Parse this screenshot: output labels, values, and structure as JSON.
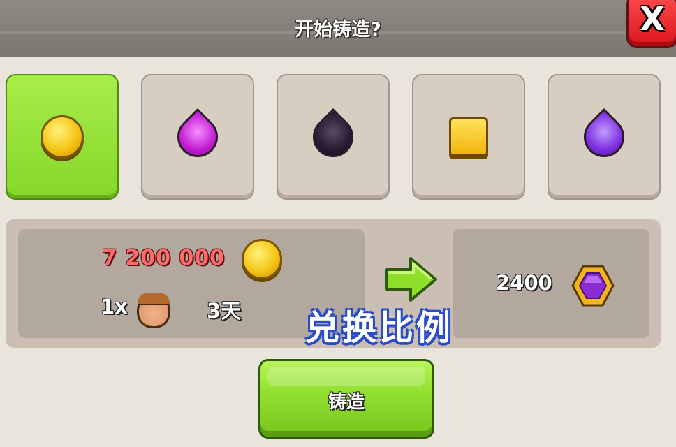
{
  "dialog": {
    "title": "开始铸造?",
    "close_label": "X"
  },
  "resources": [
    {
      "name": "gold-coin",
      "selected": true
    },
    {
      "name": "elixir",
      "selected": false
    },
    {
      "name": "dark-elixir",
      "selected": false
    },
    {
      "name": "gold-ore",
      "selected": false
    },
    {
      "name": "purple-elixir",
      "selected": false
    }
  ],
  "exchange": {
    "cost_amount": "7 200 000",
    "builder_count": "1x",
    "duration": "3天",
    "result_amount": "2400",
    "cost_icon": "gold-coin-icon",
    "result_icon": "gem-hexagon-icon"
  },
  "overlay_text": "兑换比例",
  "forge_button_label": "铸造",
  "colors": {
    "selected_tile": "#93e034",
    "cost_text": "#ff6b6b",
    "close_button": "#e81c22"
  }
}
